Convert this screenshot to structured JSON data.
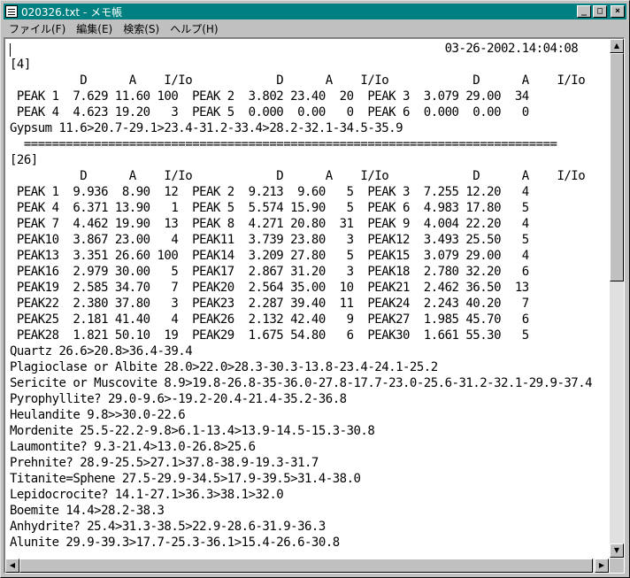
{
  "window": {
    "title": "020326.txt - メモ帳"
  },
  "title_buttons": {
    "minimize": "_",
    "maximize": "□",
    "close": "×"
  },
  "menu": [
    {
      "label": "ファイル(F)"
    },
    {
      "label": "編集(E)"
    },
    {
      "label": "検索(S)"
    },
    {
      "label": "ヘルプ(H)"
    }
  ],
  "lines": [
    "                                                              03-26-2002.14:04:08",
    "[4]",
    "          D      A    I/Io            D      A    I/Io            D      A    I/Io",
    " PEAK 1  7.629 11.60 100  PEAK 2  3.802 23.40  20  PEAK 3  3.079 29.00  34",
    " PEAK 4  4.623 19.20   3  PEAK 5  0.000  0.00   0  PEAK 6  0.000  0.00   0",
    "Gypsum 11.6>20.7-29.1>23.4-31.2-33.4>28.2-32.1-34.5-35.9",
    "  ============================================================================",
    "[26]",
    "          D      A    I/Io            D      A    I/Io            D      A    I/Io",
    " PEAK 1  9.936  8.90  12  PEAK 2  9.213  9.60   5  PEAK 3  7.255 12.20   4",
    " PEAK 4  6.371 13.90   1  PEAK 5  5.574 15.90   5  PEAK 6  4.983 17.80   5",
    " PEAK 7  4.462 19.90  13  PEAK 8  4.271 20.80  31  PEAK 9  4.004 22.20   4",
    " PEAK10  3.867 23.00   4  PEAK11  3.739 23.80   3  PEAK12  3.493 25.50   5",
    " PEAK13  3.351 26.60 100  PEAK14  3.209 27.80   5  PEAK15  3.079 29.00   4",
    " PEAK16  2.979 30.00   5  PEAK17  2.867 31.20   3  PEAK18  2.780 32.20   6",
    " PEAK19  2.585 34.70   7  PEAK20  2.564 35.00  10  PEAK21  2.462 36.50  13",
    " PEAK22  2.380 37.80   3  PEAK23  2.287 39.40  11  PEAK24  2.243 40.20   7",
    " PEAK25  2.181 41.40   4  PEAK26  2.132 42.40   9  PEAK27  1.985 45.70   6",
    " PEAK28  1.821 50.10  19  PEAK29  1.675 54.80   6  PEAK30  1.661 55.30   5",
    "Quartz 26.6>20.8>36.4-39.4",
    "Plagioclase or Albite 28.0>22.0>28.3-30.3-13.8-23.4-24.1-25.2",
    "Sericite or Muscovite 8.9>19.8-26.8-35-36.0-27.8-17.7-23.0-25.6-31.2-32.1-29.9-37.4",
    "Pyrophyllite? 29.0-9.6>-19.2-20.4-21.4-35.2-36.8",
    "Heulandite 9.8>>30.0-22.6",
    "Mordenite 25.5-22.2-9.8>6.1-13.4>13.9-14.5-15.3-30.8",
    "Laumontite? 9.3-21.4>13.0-26.8>25.6",
    "Prehnite? 28.9-25.5>27.1>37.8-38.9-19.3-31.7",
    "Titanite=Sphene 27.5-29.9-34.5>17.9-39.5>31.4-38.0",
    "Lepidocrocite? 14.1-27.1>36.3>38.1>32.0",
    "Boemite 14.4>28.2-38.3",
    "Anhydrite? 25.4>31.3-38.5>22.9-28.6-31.9-36.3",
    "Alunite 29.9-39.3>17.7-25.3-36.1>15.4-26.6-30.8"
  ]
}
